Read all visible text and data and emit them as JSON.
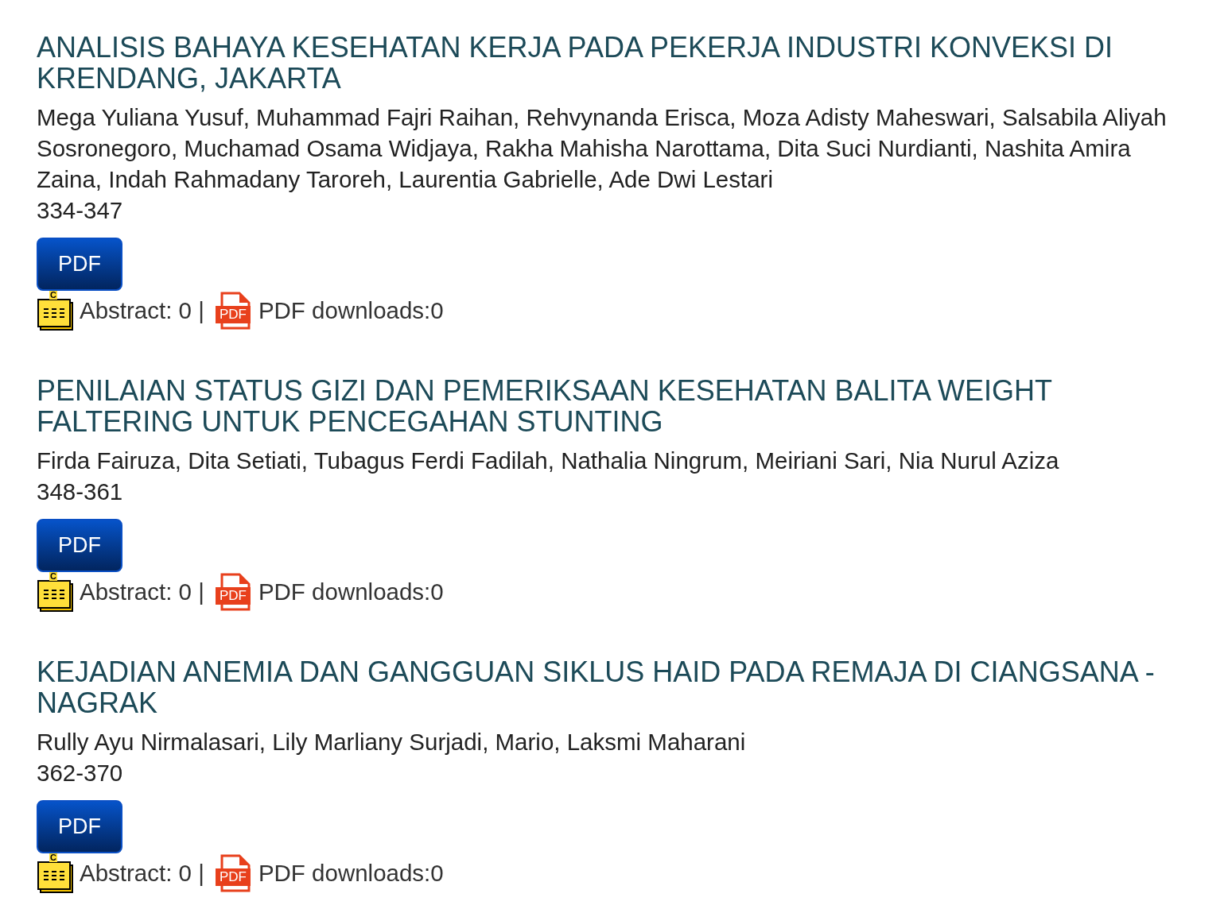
{
  "articles": [
    {
      "title": "ANALISIS BAHAYA KESEHATAN KERJA PADA PEKERJA INDUSTRI KONVEKSI DI KRENDANG, JAKARTA",
      "authors": "Mega Yuliana Yusuf, Muhammad Fajri Raihan, Rehvynanda Erisca, Moza Adisty Maheswari, Salsabila Aliyah Sosronegoro, Muchamad Osama Widjaya, Rakha Mahisha Narottama, Dita Suci Nurdianti, Nashita Amira Zaina, Indah Rahmadany Taroreh, Laurentia Gabrielle, Ade Dwi Lestari",
      "pages": "334-347",
      "button": "PDF",
      "abstract_icon_mark": "C",
      "abstract": "Abstract: 0 |",
      "pdf_icon_label": "PDF",
      "downloads": "PDF downloads:0"
    },
    {
      "title": "PENILAIAN STATUS GIZI DAN PEMERIKSAAN KESEHATAN BALITA WEIGHT FALTERING UNTUK PENCEGAHAN STUNTING",
      "authors": "Firda Fairuza, Dita Setiati, Tubagus Ferdi Fadilah, Nathalia Ningrum, Meiriani Sari, Nia Nurul Aziza",
      "pages": "348-361",
      "button": "PDF",
      "abstract_icon_mark": "C",
      "abstract": "Abstract: 0 |",
      "pdf_icon_label": "PDF",
      "downloads": "PDF downloads:0"
    },
    {
      "title": "KEJADIAN ANEMIA DAN GANGGUAN SIKLUS HAID PADA REMAJA DI CIANGSANA - NAGRAK",
      "authors": "Rully Ayu Nirmalasari, Lily Marliany Surjadi, Mario, Laksmi Maharani",
      "pages": "362-370",
      "button": "PDF",
      "abstract_icon_mark": "C",
      "abstract": "Abstract: 0 |",
      "pdf_icon_label": "PDF",
      "downloads": "PDF downloads:0"
    }
  ]
}
